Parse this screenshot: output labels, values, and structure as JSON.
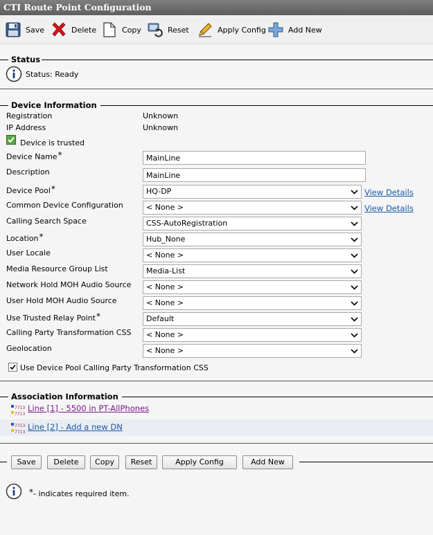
{
  "window": {
    "title": "CTI Route Point Configuration"
  },
  "toolbar": {
    "save": "Save",
    "delete": "Delete",
    "copy": "Copy",
    "reset": "Reset",
    "apply_config": "Apply Config",
    "add_new": "Add New"
  },
  "status": {
    "heading": "Status",
    "text": "Status: Ready"
  },
  "device": {
    "heading": "Device Information",
    "registration_label": "Registration",
    "registration_value": "Unknown",
    "ip_label": "IP Address",
    "ip_value": "Unknown",
    "trusted_text": "Device is trusted",
    "fields": {
      "device_name": {
        "label": "Device Name",
        "value": "MainLine"
      },
      "description": {
        "label": "Description",
        "value": "MainLine"
      },
      "device_pool": {
        "label": "Device Pool",
        "value": "HQ-DP"
      },
      "common_device_config": {
        "label": "Common Device Configuration",
        "value": "< None >"
      },
      "css": {
        "label": "Calling Search Space",
        "value": "CSS-AutoRegistration"
      },
      "location": {
        "label": "Location",
        "value": "Hub_None"
      },
      "user_locale": {
        "label": "User Locale",
        "value": "< None >"
      },
      "mrgl": {
        "label": "Media Resource Group List",
        "value": "Media-List"
      },
      "network_hold_moh": {
        "label": "Network Hold MOH Audio Source",
        "value": "< None >"
      },
      "user_hold_moh": {
        "label": "User Hold MOH Audio Source",
        "value": "< None >"
      },
      "trusted_relay": {
        "label": "Use Trusted Relay Point",
        "value": "Default"
      },
      "calling_party_css": {
        "label": "Calling Party Transformation CSS",
        "value": "< None >"
      },
      "geolocation": {
        "label": "Geolocation",
        "value": "< None >"
      }
    },
    "view_details": "View Details",
    "use_pool_css_label": "Use Device Pool Calling Party Transformation CSS",
    "use_pool_css_checked": true,
    "required_marker": "*"
  },
  "association": {
    "heading": "Association Information",
    "lines": [
      {
        "text": "Line [1] - 5500 in PT-AllPhones",
        "color": "#7a1a8a"
      },
      {
        "text": "Line [2] - Add a new DN",
        "color": "#1a5aa8"
      }
    ]
  },
  "bottom_buttons": {
    "save": "Save",
    "delete": "Delete",
    "copy": "Copy",
    "reset": "Reset",
    "apply_config": "Apply Config",
    "add_new": "Add New"
  },
  "footer": {
    "marker": "*",
    "note": "- indicates required item."
  },
  "colors": {
    "titlebar": "#6e6e6e",
    "link": "#1a5aa8",
    "visited_link": "#7a1a8a"
  }
}
